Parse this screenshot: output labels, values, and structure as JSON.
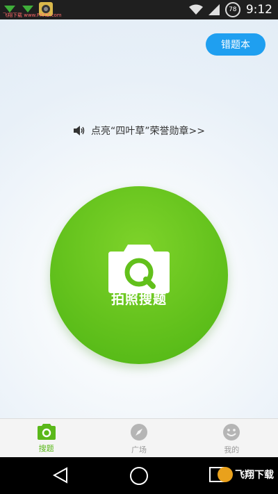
{
  "status_bar": {
    "watermark_text": "飞翔下载 www.FXXZ.com",
    "battery_level": "78",
    "time": "9:12"
  },
  "main": {
    "wrong_book_label": "错题本",
    "notice_text": "点亮“四叶草”荣誉勋章>>",
    "capture_label": "拍照搜题",
    "accent_color": "#66c31d",
    "button_color": "#1f9ff0"
  },
  "tabs": [
    {
      "label": "搜题",
      "icon": "camera-icon",
      "active": true
    },
    {
      "label": "广场",
      "icon": "compass-icon",
      "active": false
    },
    {
      "label": "我的",
      "icon": "smiley-icon",
      "active": false
    }
  ],
  "nav": {
    "icons": [
      "back-icon",
      "home-icon",
      "recents-icon"
    ],
    "watermark_logo": "飞翔下载"
  }
}
